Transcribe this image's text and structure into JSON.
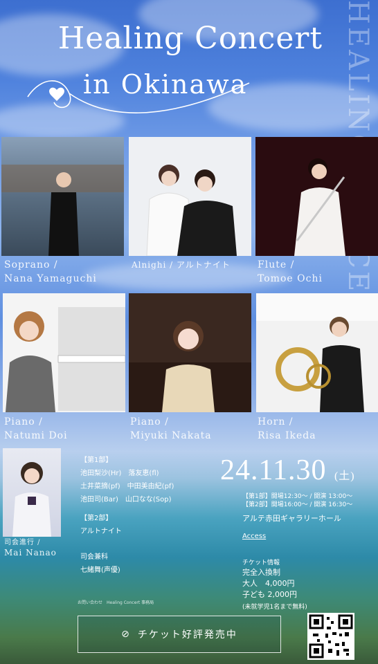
{
  "title": {
    "line1": "Healing Concert",
    "line2": "in Okinawa",
    "vertical": "HEALING CONCERT"
  },
  "performers": [
    {
      "role": "Soprano /",
      "name": "Nana Yamaguchi"
    },
    {
      "role": "Alnighi / アルトナイト",
      "name": ""
    },
    {
      "role": "Flute /",
      "name": "Tomoe Ochi"
    },
    {
      "role": "Piano /",
      "name": "Natumi Doi"
    },
    {
      "role": "Piano /",
      "name": "Miyuki Nakata"
    },
    {
      "role": "Horn /",
      "name": "Risa Ikeda"
    }
  ],
  "mc": {
    "role": "司会進行 /",
    "name": "Mai Nanao"
  },
  "program": {
    "part1_label": "【第1部】",
    "part1_lines": [
      "池田梨沙(Hr)　落友恵(fl)",
      "土井菜摘(pf)　中田美由紀(pf)",
      "池田司(Bar)　山口なな(Sop)"
    ],
    "part2_label": "【第2部】",
    "part2_line": "アルトナイト",
    "mc_label": "司会兼科",
    "mc_line": "七緒舞(声優)"
  },
  "date": "24.11.30",
  "weekday": "(土)",
  "schedule": {
    "part1": "【第1部】開場12:30〜 / 開演 13:00〜",
    "part2": "【第2部】開場16:00〜 / 開演 16:30〜"
  },
  "venue": "アルテ赤田ギャラリーホール",
  "access_label": "Access",
  "ticket_info": {
    "label": "チケット情報",
    "system": "完全入換制",
    "adult": "大人　4,000円",
    "child": "子ども 2,000円",
    "note": "(未就学児1名まで無料)"
  },
  "ticket_button": "チケット好評発売中",
  "contact": "お問い合わせ　Healing Concert 事務局"
}
